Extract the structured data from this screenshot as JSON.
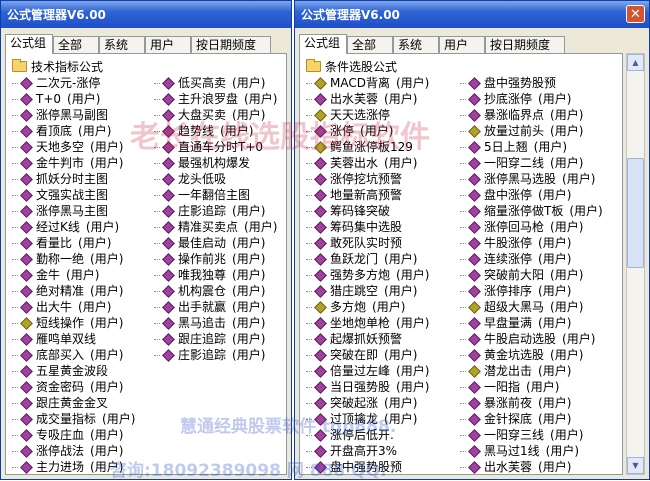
{
  "left": {
    "title": "公式管理器V6.00",
    "tabs": [
      "公式组",
      "全部",
      "系统",
      "用户",
      "按日期频度"
    ],
    "root": "技术指标公式",
    "col1": [
      {
        "name": "二次元-涨停",
        "tag": "",
        "icon": "p"
      },
      {
        "name": "T+0",
        "tag": "(用户)",
        "icon": "p"
      },
      {
        "name": "涨停黑马副图",
        "tag": "",
        "icon": "p"
      },
      {
        "name": "看顶底",
        "tag": "(用户)",
        "icon": "p"
      },
      {
        "name": "天地多空",
        "tag": "(用户)",
        "icon": "p"
      },
      {
        "name": "金牛判市",
        "tag": "(用户)",
        "icon": "p"
      },
      {
        "name": "抓妖分时主图",
        "tag": "",
        "icon": "p"
      },
      {
        "name": "文强实战主图",
        "tag": "",
        "icon": "p"
      },
      {
        "name": "涨停黑马主图",
        "tag": "",
        "icon": "p"
      },
      {
        "name": "经过K线",
        "tag": "(用户)",
        "icon": "p"
      },
      {
        "name": "看量比",
        "tag": "(用户)",
        "icon": "p"
      },
      {
        "name": "勤称一绝",
        "tag": "(用户)",
        "icon": "p"
      },
      {
        "name": "金牛",
        "tag": "(用户)",
        "icon": "p"
      },
      {
        "name": "绝对精准",
        "tag": "(用户)",
        "icon": "p"
      },
      {
        "name": "出大牛",
        "tag": "(用户)",
        "icon": "p"
      },
      {
        "name": "短线操作",
        "tag": "(用户)",
        "icon": "g"
      },
      {
        "name": "雁鸣单双线",
        "tag": "",
        "icon": "p"
      },
      {
        "name": "底部买入",
        "tag": "(用户)",
        "icon": "p"
      },
      {
        "name": "五星黄金波段",
        "tag": "",
        "icon": "p"
      },
      {
        "name": "资金密码",
        "tag": "(用户)",
        "icon": "p"
      },
      {
        "name": "跟庄黄金金叉",
        "tag": "",
        "icon": "p"
      },
      {
        "name": "成交量指标",
        "tag": "(用户)",
        "icon": "p"
      },
      {
        "name": "专吸庄血",
        "tag": "(用户)",
        "icon": "p"
      },
      {
        "name": "涨停战法",
        "tag": "(用户)",
        "icon": "p"
      },
      {
        "name": "主力进场",
        "tag": "(用户)",
        "icon": "p"
      }
    ],
    "col2": [
      {
        "name": "低买高卖",
        "tag": "(用户)",
        "icon": "p"
      },
      {
        "name": "主升浪罗盘",
        "tag": "(用户)",
        "icon": "p"
      },
      {
        "name": "大盘买卖",
        "tag": "(用户)",
        "icon": "p"
      },
      {
        "name": "趋势线",
        "tag": "(用户)",
        "icon": "p"
      },
      {
        "name": "直通车分时T+0",
        "tag": "",
        "icon": "p"
      },
      {
        "name": "最强机构爆发",
        "tag": "",
        "icon": "p"
      },
      {
        "name": "龙头低吸",
        "tag": "",
        "icon": "p"
      },
      {
        "name": "一年翻倍主图",
        "tag": "",
        "icon": "p"
      },
      {
        "name": "庄影追踪",
        "tag": "(用户)",
        "icon": "p"
      },
      {
        "name": "精准买卖点",
        "tag": "(用户)",
        "icon": "p"
      },
      {
        "name": "最佳启动",
        "tag": "(用户)",
        "icon": "p"
      },
      {
        "name": "操作前兆",
        "tag": "(用户)",
        "icon": "p"
      },
      {
        "name": "唯我独尊",
        "tag": "(用户)",
        "icon": "p"
      },
      {
        "name": "机构震仓",
        "tag": "(用户)",
        "icon": "p"
      },
      {
        "name": "出手就赢",
        "tag": "(用户)",
        "icon": "p"
      },
      {
        "name": "黑马追击",
        "tag": "(用户)",
        "icon": "p"
      },
      {
        "name": "跟庄追踪",
        "tag": "(用户)",
        "icon": "p"
      },
      {
        "name": "庄影追踪",
        "tag": "(用户)",
        "icon": "p"
      }
    ]
  },
  "right": {
    "title": "公式管理器V6.00",
    "tabs": [
      "公式组",
      "全部",
      "系统",
      "用户",
      "按日期频度"
    ],
    "root": "条件选股公式",
    "col1": [
      {
        "name": "MACD背离",
        "tag": "(用户)",
        "icon": "g"
      },
      {
        "name": "出水芙蓉",
        "tag": "(用户)",
        "icon": "p"
      },
      {
        "name": "天天选涨停",
        "tag": "",
        "icon": "g"
      },
      {
        "name": "涨停",
        "tag": "(用户)",
        "icon": "p"
      },
      {
        "name": "鳄鱼涨停板129",
        "tag": "",
        "icon": "g"
      },
      {
        "name": "芙蓉出水",
        "tag": "(用户)",
        "icon": "p"
      },
      {
        "name": "涨停挖坑预警",
        "tag": "",
        "icon": "p"
      },
      {
        "name": "地量新高预警",
        "tag": "",
        "icon": "p"
      },
      {
        "name": "筹码锋突破",
        "tag": "",
        "icon": "p"
      },
      {
        "name": "筹码集中选股",
        "tag": "",
        "icon": "p"
      },
      {
        "name": "敢死队实时预",
        "tag": "",
        "icon": "p"
      },
      {
        "name": "鱼跃龙门",
        "tag": "(用户)",
        "icon": "p"
      },
      {
        "name": "强势多方炮",
        "tag": "(用户)",
        "icon": "p"
      },
      {
        "name": "猎庄跳空",
        "tag": "(用户)",
        "icon": "p"
      },
      {
        "name": "多方炮",
        "tag": "(用户)",
        "icon": "g"
      },
      {
        "name": "坐地炮单枪",
        "tag": "(用户)",
        "icon": "p"
      },
      {
        "name": "起爆抓妖预警",
        "tag": "",
        "icon": "p"
      },
      {
        "name": "突破在即",
        "tag": "(用户)",
        "icon": "p"
      },
      {
        "name": "倍量过左峰",
        "tag": "(用户)",
        "icon": "p"
      },
      {
        "name": "当日强势股",
        "tag": "(用户)",
        "icon": "p"
      },
      {
        "name": "突破起涨",
        "tag": "(用户)",
        "icon": "p"
      },
      {
        "name": "过顶擒龙",
        "tag": "(用户)",
        "icon": "p"
      },
      {
        "name": "涨停后低开.",
        "tag": "",
        "icon": "p"
      },
      {
        "name": "开盘高开3%",
        "tag": "",
        "icon": "p"
      },
      {
        "name": "盘中强势股预",
        "tag": "",
        "icon": "p"
      }
    ],
    "col2": [
      {
        "name": "盘中强势股预",
        "tag": "",
        "icon": "p"
      },
      {
        "name": "抄底涨停",
        "tag": "(用户)",
        "icon": "p"
      },
      {
        "name": "暴涨临界点",
        "tag": "(用户)",
        "icon": "p"
      },
      {
        "name": "放量过前头",
        "tag": "(用户)",
        "icon": "g"
      },
      {
        "name": "5日上翘",
        "tag": "(用户)",
        "icon": "p"
      },
      {
        "name": "一阳穿二线",
        "tag": "(用户)",
        "icon": "p"
      },
      {
        "name": "涨停黑马选股",
        "tag": "(用户)",
        "icon": "p"
      },
      {
        "name": "盘中涨停",
        "tag": "(用户)",
        "icon": "p"
      },
      {
        "name": "缩量涨停做T板",
        "tag": "(用户)",
        "icon": "p"
      },
      {
        "name": "涨停回马枪",
        "tag": "(用户)",
        "icon": "p"
      },
      {
        "name": "牛股涨停",
        "tag": "(用户)",
        "icon": "p"
      },
      {
        "name": "连续涨停",
        "tag": "(用户)",
        "icon": "p"
      },
      {
        "name": "突破前大阳",
        "tag": "(用户)",
        "icon": "p"
      },
      {
        "name": "涨停排序",
        "tag": "(用户)",
        "icon": "p"
      },
      {
        "name": "超级大黑马",
        "tag": "(用户)",
        "icon": "g"
      },
      {
        "name": "早盘量满",
        "tag": "(用户)",
        "icon": "p"
      },
      {
        "name": "牛股启动选股",
        "tag": "(用户)",
        "icon": "p"
      },
      {
        "name": "黄金坑选股",
        "tag": "(用户)",
        "icon": "p"
      },
      {
        "name": "潜龙出击",
        "tag": "(用户)",
        "icon": "g"
      },
      {
        "name": "一阳指",
        "tag": "(用户)",
        "icon": "p"
      },
      {
        "name": "暴涨前夜",
        "tag": "(用户)",
        "icon": "p"
      },
      {
        "name": "金针探底",
        "tag": "(用户)",
        "icon": "p"
      },
      {
        "name": "一阳穿三线",
        "tag": "(用户)",
        "icon": "p"
      },
      {
        "name": "黑马过1线",
        "tag": "(用户)",
        "icon": "p"
      },
      {
        "name": "出水芙蓉",
        "tag": "(用户)",
        "icon": "p"
      }
    ]
  },
  "watermarks": {
    "top": "老长在线选股指标软件",
    "bottom1": "慧通经典股票软件  tgp888.",
    "bottom2": "咨询:18092389098  网  888  QQ:"
  }
}
